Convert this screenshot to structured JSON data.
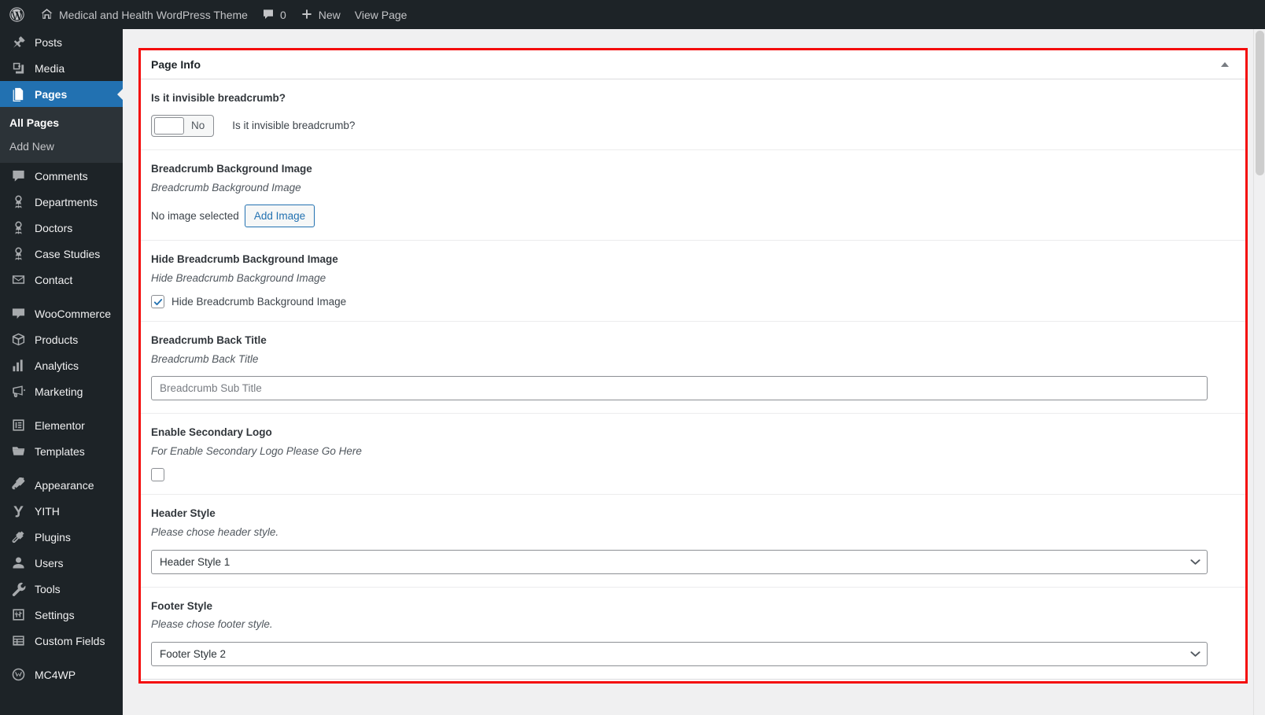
{
  "adminbar": {
    "logo_icon": "wordpress-logo-icon",
    "site": {
      "icon": "home-icon",
      "label": "Medical and Health WordPress Theme"
    },
    "comments": {
      "icon": "comment-bubble-icon",
      "count": "0"
    },
    "new": {
      "icon": "plus-icon",
      "label": "New"
    },
    "view_page": {
      "label": "View Page"
    }
  },
  "sidebar": {
    "items": [
      {
        "label": "Posts",
        "icon": "pin-icon",
        "current": false
      },
      {
        "label": "Media",
        "icon": "media-icon",
        "current": false
      },
      {
        "label": "Pages",
        "icon": "pages-icon",
        "current": true
      },
      {
        "label": "Comments",
        "icon": "comment-bubble-icon",
        "current": false
      },
      {
        "label": "Departments",
        "icon": "award-icon",
        "current": false
      },
      {
        "label": "Doctors",
        "icon": "award-icon",
        "current": false
      },
      {
        "label": "Case Studies",
        "icon": "award-icon",
        "current": false
      },
      {
        "label": "Contact",
        "icon": "envelope-icon",
        "current": false
      },
      {
        "label": "WooCommerce",
        "icon": "woo-icon",
        "current": false
      },
      {
        "label": "Products",
        "icon": "box-icon",
        "current": false
      },
      {
        "label": "Analytics",
        "icon": "bar-chart-icon",
        "current": false
      },
      {
        "label": "Marketing",
        "icon": "megaphone-icon",
        "current": false
      },
      {
        "label": "Elementor",
        "icon": "elementor-icon",
        "current": false
      },
      {
        "label": "Templates",
        "icon": "folder-icon",
        "current": false
      },
      {
        "label": "Appearance",
        "icon": "paintbrush-icon",
        "current": false
      },
      {
        "label": "YITH",
        "icon": "yith-icon",
        "current": false
      },
      {
        "label": "Plugins",
        "icon": "plug-icon",
        "current": false
      },
      {
        "label": "Users",
        "icon": "user-icon",
        "current": false
      },
      {
        "label": "Tools",
        "icon": "wrench-icon",
        "current": false
      },
      {
        "label": "Settings",
        "icon": "sliders-icon",
        "current": false
      },
      {
        "label": "Custom Fields",
        "icon": "table-icon",
        "current": false
      },
      {
        "label": "MC4WP",
        "icon": "mc4wp-icon",
        "current": false
      }
    ],
    "submenu": {
      "items": [
        {
          "label": "All Pages",
          "current": true
        },
        {
          "label": "Add New",
          "current": false
        }
      ]
    }
  },
  "metabox": {
    "title": "Page Info",
    "collapse_icon": "chevron-up-icon",
    "highlight_color": "#f40b0b",
    "fields": {
      "invisible_breadcrumb": {
        "label": "Is it invisible breadcrumb?",
        "switch_value": "No",
        "side_label": "Is it invisible breadcrumb?"
      },
      "breadcrumb_bg_image": {
        "label": "Breadcrumb Background Image",
        "desc": "Breadcrumb Background Image",
        "status": "No image selected",
        "button": "Add Image"
      },
      "hide_breadcrumb_bg": {
        "label": "Hide Breadcrumb Background Image",
        "desc": "Hide Breadcrumb Background Image",
        "checkbox_label": "Hide Breadcrumb Background Image",
        "checked": true
      },
      "breadcrumb_back_title": {
        "label": "Breadcrumb Back Title",
        "desc": "Breadcrumb Back Title",
        "value": "",
        "placeholder": "Breadcrumb Sub Title"
      },
      "enable_secondary_logo": {
        "label": "Enable Secondary Logo",
        "desc": "For Enable Secondary Logo Please Go Here",
        "checkbox_label": "",
        "checked": false
      },
      "header_style": {
        "label": "Header Style",
        "desc": "Please chose header style.",
        "value": "Header Style 1",
        "chevron": "chevron-down-icon"
      },
      "footer_style": {
        "label": "Footer Style",
        "desc": "Please chose footer style.",
        "value": "Footer Style 2",
        "chevron": "chevron-down-icon"
      }
    }
  }
}
